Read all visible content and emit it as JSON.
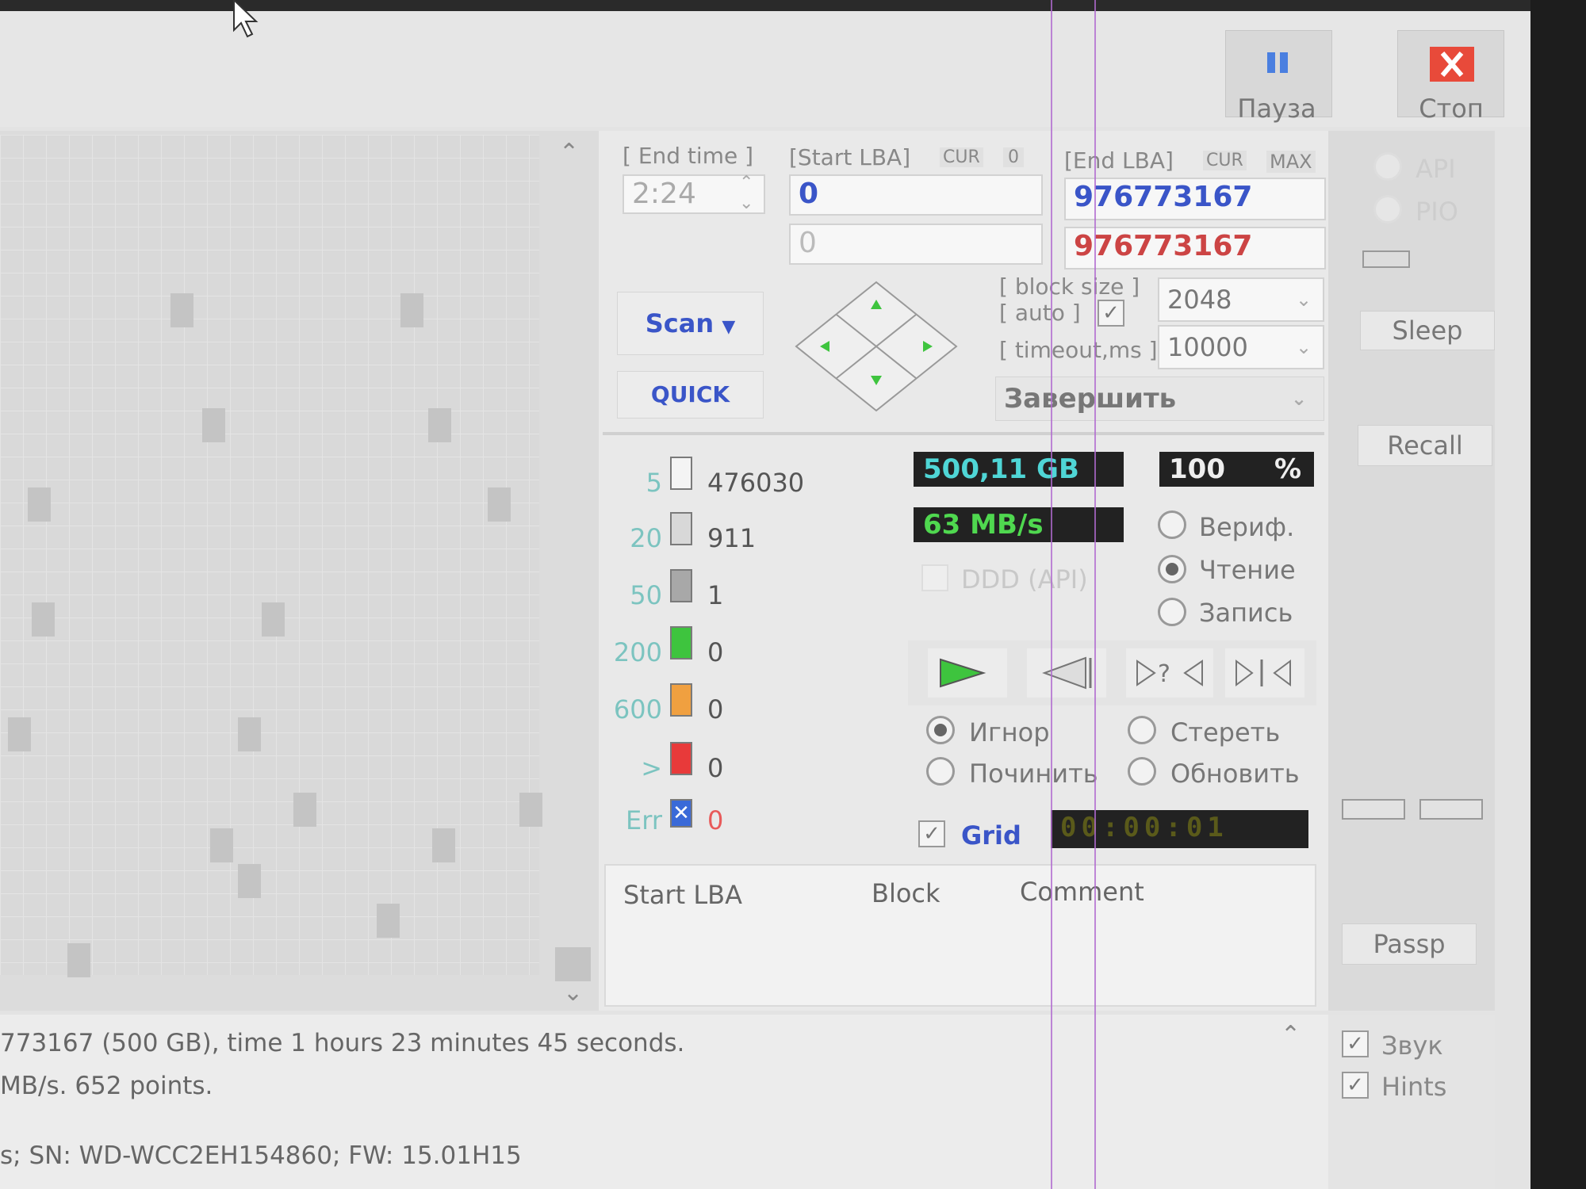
{
  "toolbar": {
    "pause_label": "Пауза",
    "stop_label": "Стоп"
  },
  "scan_params": {
    "end_time_label": "[ End time ]",
    "end_time_value": "2:24",
    "start_lba_label": "[Start LBA]",
    "start_lba_cur": "CUR",
    "start_lba_zero": "0",
    "start_lba_value": "0",
    "start_lba_current": "0",
    "end_lba_label": "[End LBA]",
    "end_lba_cur": "CUR",
    "end_lba_max": "MAX",
    "end_lba_value": "976773167",
    "end_lba_current": "976773167",
    "block_size_label": "[ block size ]",
    "auto_label": "[ auto ]",
    "block_size_value": "2048",
    "timeout_label": "[ timeout,ms ]",
    "timeout_value": "10000",
    "finish_action": "Завершить",
    "scan_button": "Scan",
    "quick_button": "QUICK"
  },
  "legend": [
    {
      "threshold": "5",
      "count": "476030",
      "color": "#f4f4f4"
    },
    {
      "threshold": "20",
      "count": "911",
      "color": "#d8d8d8"
    },
    {
      "threshold": "50",
      "count": "1",
      "color": "#a8a8a8"
    },
    {
      "threshold": "200",
      "count": "0",
      "color": "#3ec43e"
    },
    {
      "threshold": "600",
      "count": "0",
      "color": "#f0a040"
    },
    {
      "threshold": ">",
      "count": "0",
      "color": "#e83a3a"
    },
    {
      "threshold": "Err",
      "count": "0",
      "color": "#3a6ad8"
    }
  ],
  "stats": {
    "size": "500,11 GB",
    "percent": "100",
    "percent_sign": "%",
    "speed": "63 MB/s",
    "ddd_label": "DDD (API)",
    "timer": "00:00:01"
  },
  "modes": {
    "verify": "Вериф.",
    "read": "Чтение",
    "write": "Запись"
  },
  "actions": {
    "ignore": "Игнор",
    "erase": "Стереть",
    "repair": "Починить",
    "refresh": "Обновить"
  },
  "grid_label": "Grid",
  "table_headers": [
    "Start LBA",
    "Block",
    "Comment"
  ],
  "sidebar": {
    "api": "API",
    "pio": "PIO",
    "sleep": "Sleep",
    "recall": "Recall",
    "passp": "Passp",
    "sound": "Звук",
    "hints": "Hints"
  },
  "log_lines": [
    "773167 (500 GB), time 1 hours 23 minutes 45 seconds.",
    " MB/s. 652 points.",
    "s; SN: WD-WCC2EH154860; FW: 15.01H15"
  ],
  "colors": {
    "accent_blue": "#3a55c8",
    "lcd_cyan": "#4fd6d6",
    "lcd_green": "#4fd84f",
    "red_value": "#c44"
  }
}
